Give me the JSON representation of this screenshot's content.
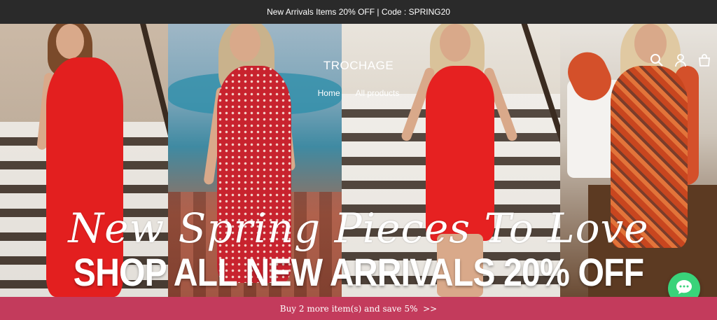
{
  "announcement": {
    "text": "New Arrivals Items 20% OFF | Code : SPRING20"
  },
  "header": {
    "brand": "TROCHAGE",
    "nav": [
      {
        "label": "Home"
      },
      {
        "label": "All products"
      }
    ],
    "icons": [
      "search-icon",
      "account-icon",
      "cart-icon"
    ]
  },
  "hero": {
    "script_title": "New Spring Pieces To Love",
    "cta": "SHOP ALL NEW ARRIVALS 20% OFF"
  },
  "promo_bar": {
    "text": "Buy 2 more item(s) and save 5%  >>"
  },
  "chat": {
    "icon": "chat-bubble-icon",
    "color": "#39d37a"
  },
  "colors": {
    "announcement_bg": "#2a2a2a",
    "promo_bg": "#c33b5c"
  }
}
